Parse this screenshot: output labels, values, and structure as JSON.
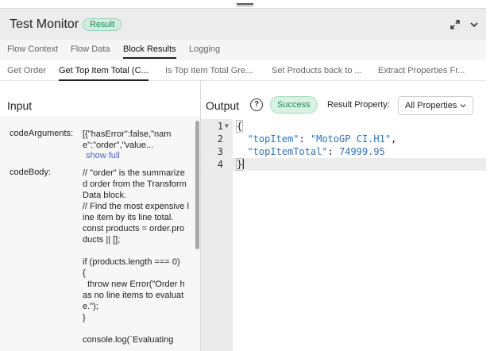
{
  "header": {
    "title": "Test Monitor",
    "badge": "Result"
  },
  "tabs": [
    "Flow Context",
    "Flow Data",
    "Block Results",
    "Logging"
  ],
  "active_tab": "Block Results",
  "subtabs": [
    "Get Order",
    "Get Top Item Total (C...",
    "Is Top Item Total Gre...",
    "Set Products back to ...",
    "Extract Properties Fr..."
  ],
  "active_subtab": "Get Top Item Total (C...",
  "input": {
    "title": "Input",
    "args": [
      {
        "label": "codeArguments:",
        "value": "[{\"hasError\":false,\"name\":\"order\",\"value...",
        "link": "show full"
      },
      {
        "label": "codeBody:",
        "value": "// \"order\" is the summarized order from the Transform Data block.\n// Find the most expensive line item by its line total.\nconst products = order.products || [];\n\nif (products.length === 0)\n{\n  throw new Error(\"Order has no line items to evaluate.\");\n}\n\nconsole.log(`Evaluating"
      }
    ]
  },
  "output": {
    "title": "Output",
    "help_icon": "question-circle-icon",
    "status": "Success",
    "result_property_label": "Result Property:",
    "result_property_value": "All Properties",
    "code_lines": [
      {
        "num": "1",
        "text": "{"
      },
      {
        "num": "2",
        "key": "\"topItem\"",
        "sep": ": ",
        "value": "\"MotoGP CI.H1\"",
        "tail": ","
      },
      {
        "num": "3",
        "key": "\"topItemTotal\"",
        "sep": ": ",
        "value": "74999.95",
        "tail": ""
      },
      {
        "num": "4",
        "text": "}"
      }
    ]
  },
  "colors": {
    "success_bg": "#d9f1e3",
    "success_text": "#1b8c54",
    "json_token": "#2f73b6",
    "link": "#4a67c9"
  }
}
